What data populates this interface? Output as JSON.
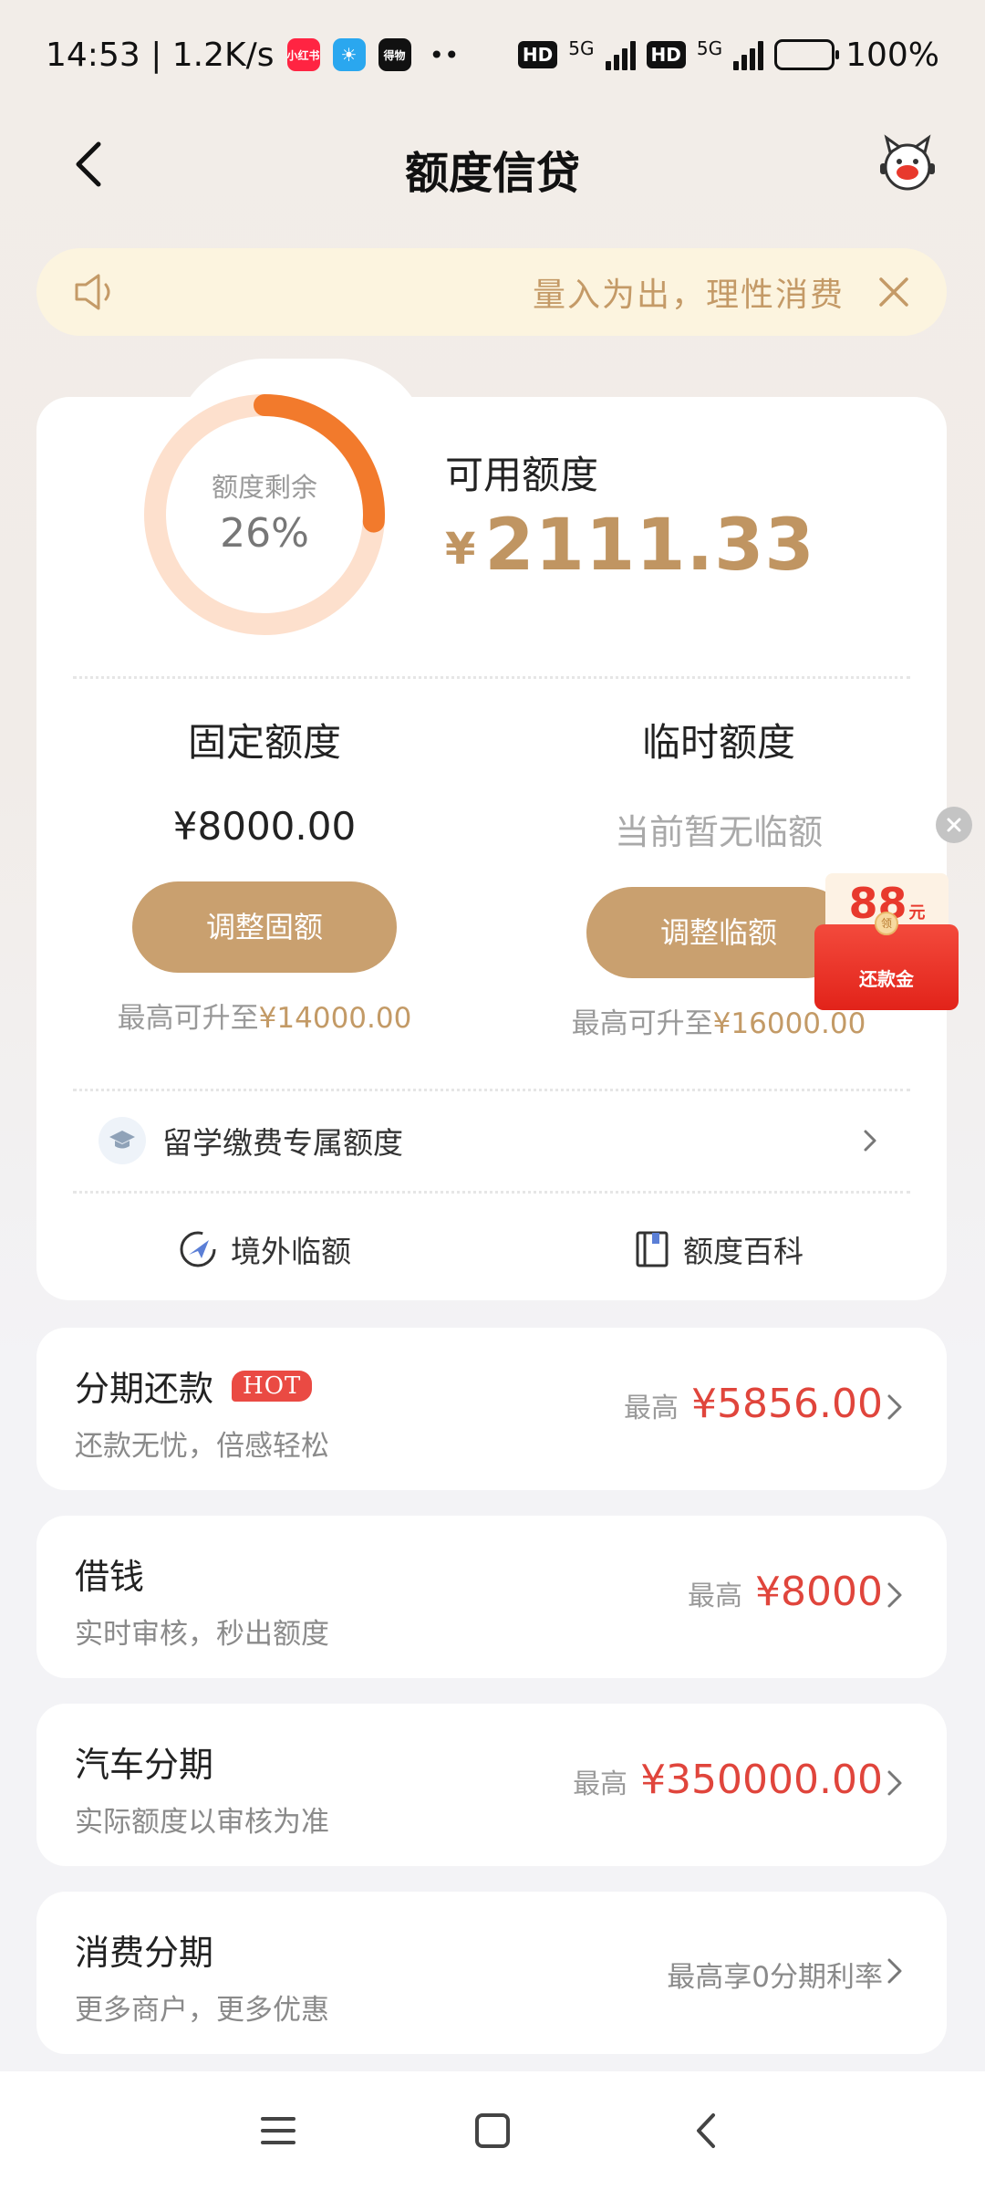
{
  "status": {
    "time_speed": "14:53 | 1.2K/s",
    "app_badges": [
      {
        "label": "小红书",
        "color": "#ff2442"
      },
      {
        "label": "☀",
        "color": "#2aa7ef"
      },
      {
        "label": "得物",
        "color": "#111111"
      }
    ],
    "more_dots": "••",
    "hd1": "HD",
    "net1": "5G",
    "hd2": "HD",
    "net2": "5G",
    "battery_text": "100%"
  },
  "nav": {
    "title": "额度信贷"
  },
  "notice": {
    "text": "量入为出，理性消费"
  },
  "quota": {
    "ring_label": "额度剩余",
    "ring_value": "26%",
    "ring_fraction": 0.26,
    "available_label": "可用额度",
    "currency": "¥",
    "available_amount": "2111.33",
    "fixed": {
      "title": "固定额度",
      "value": "¥8000.00",
      "button": "调整固额",
      "note_prefix": "最高可升至",
      "note_amount": "¥14000.00"
    },
    "temp": {
      "title": "临时额度",
      "value": "当前暂无临额",
      "button": "调整临额",
      "note_prefix": "最高可升至",
      "note_amount": "¥16000.00"
    },
    "study_label": "留学缴费专属额度",
    "overseas_label": "境外临额",
    "encyclopedia_label": "额度百科"
  },
  "red_packet": {
    "amount": "88",
    "unit": "元",
    "seal": "领",
    "label": "还款金"
  },
  "services": [
    {
      "title": "分期还款",
      "badge": "HOT",
      "subtitle": "还款无忧，倍感轻松",
      "prefix": "最高",
      "amount": "¥5856.00"
    },
    {
      "title": "借钱",
      "subtitle": "实时审核，秒出额度",
      "prefix": "最高",
      "amount": "¥8000"
    },
    {
      "title": "汽车分期",
      "subtitle": "实际额度以审核为准",
      "prefix": "最高",
      "amount": "¥350000.00"
    },
    {
      "title": "消费分期",
      "subtitle": "更多商户，更多优惠",
      "plain": "最高享0分期利率"
    }
  ],
  "colors": {
    "accent": "#c9a06f",
    "amount_red": "#e0453c",
    "ring_orange": "#f27a2c",
    "ring_track": "#fde0cd"
  }
}
